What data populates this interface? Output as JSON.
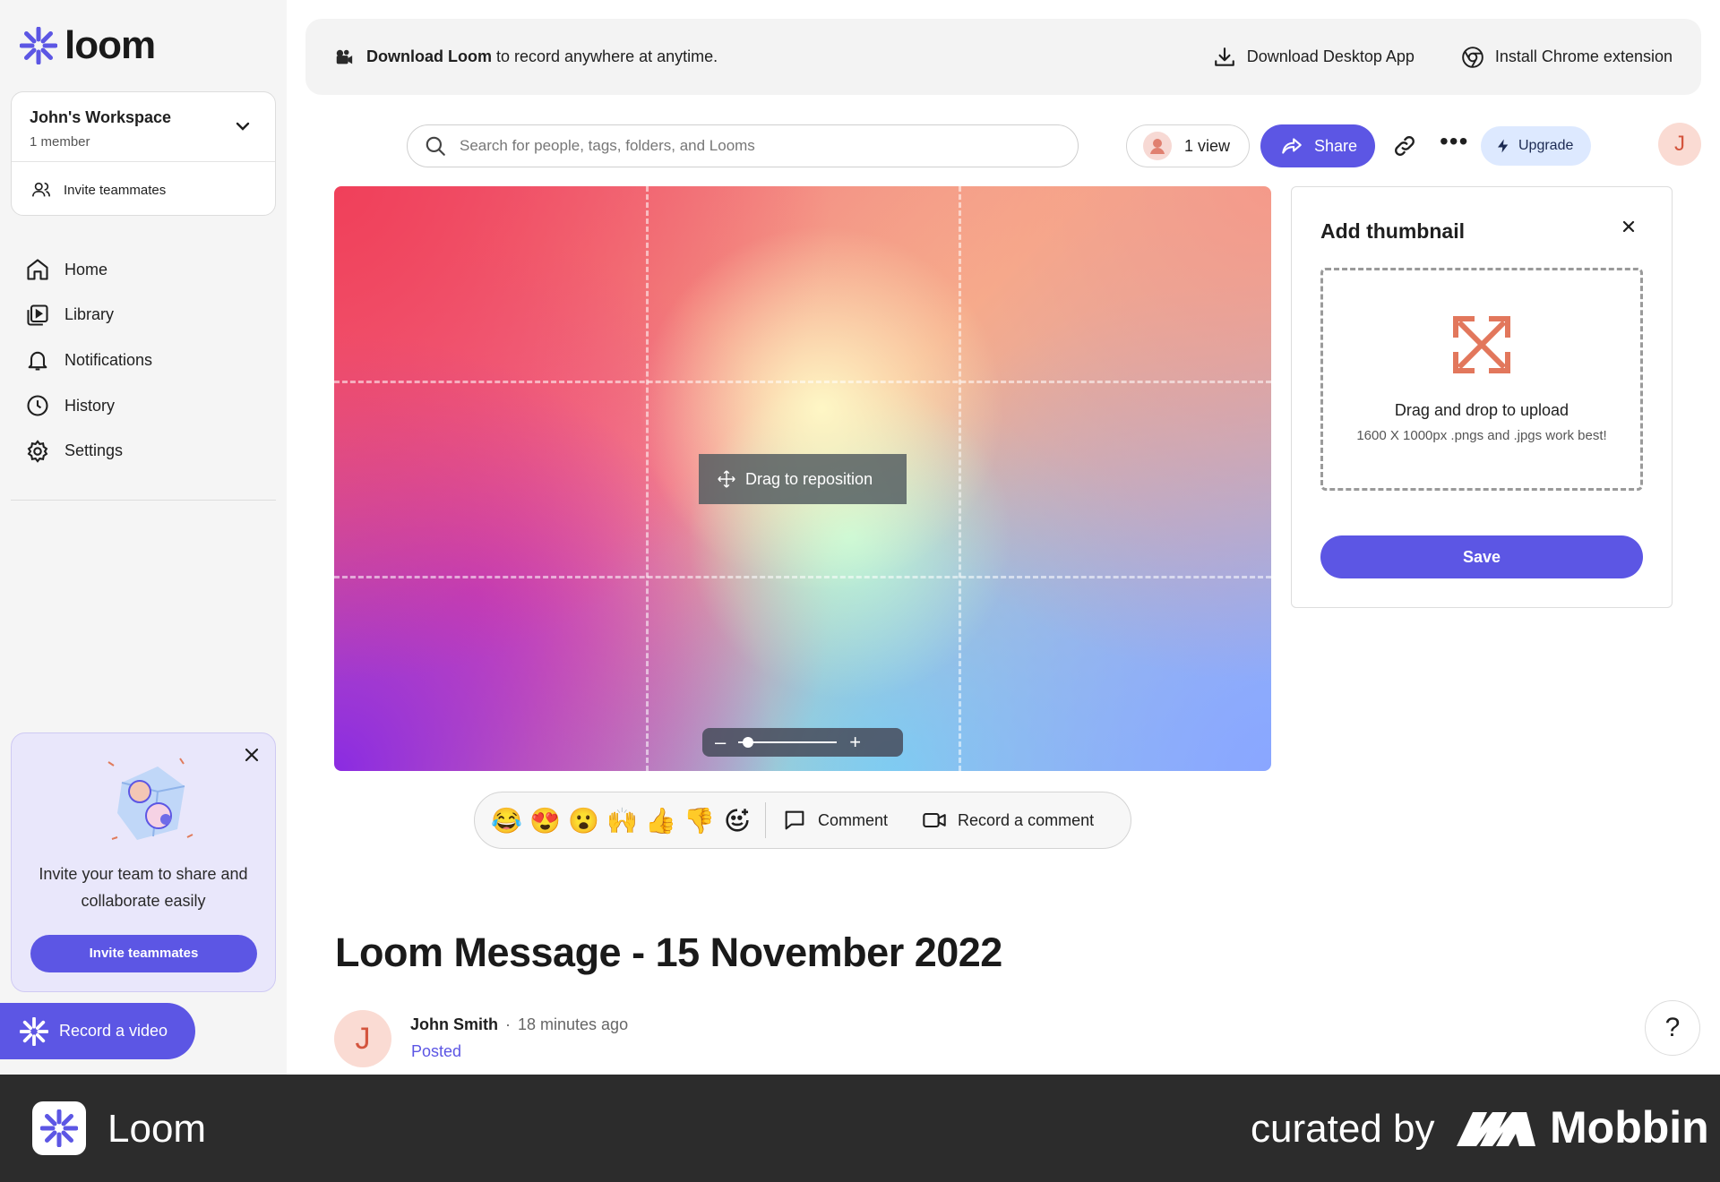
{
  "brand": {
    "logo_text": "loom",
    "accent": "#5c56e4"
  },
  "workspace": {
    "name": "John's Workspace",
    "members": "1 member",
    "invite_label": "Invite teammates"
  },
  "nav": {
    "items": [
      {
        "label": "Home",
        "icon": "home-icon"
      },
      {
        "label": "Library",
        "icon": "library-icon"
      },
      {
        "label": "Notifications",
        "icon": "bell-icon"
      },
      {
        "label": "History",
        "icon": "clock-icon"
      },
      {
        "label": "Settings",
        "icon": "gear-icon"
      }
    ]
  },
  "promo": {
    "text": "Invite your team to share and collaborate easily",
    "button": "Invite teammates"
  },
  "record_button": "Record a video",
  "banner": {
    "bold": "Download Loom",
    "rest": "to record anywhere at anytime.",
    "download_app": "Download Desktop App",
    "chrome_ext": "Install Chrome extension"
  },
  "search": {
    "placeholder": "Search for people, tags, folders, and Looms"
  },
  "toolbar": {
    "views": "1 view",
    "share": "Share",
    "upgrade": "Upgrade",
    "user_initial": "J"
  },
  "video": {
    "drag_tip": "Drag to reposition",
    "zoom_level": 0.1
  },
  "reactions": {
    "emojis": [
      "😂",
      "😍",
      "😮",
      "🙌",
      "👍",
      "👎"
    ],
    "comment": "Comment",
    "record_comment": "Record a comment"
  },
  "thumbnail_panel": {
    "title": "Add thumbnail",
    "drop_title": "Drag and drop to upload",
    "drop_hint": "1600 X 1000px .pngs and .jpgs work best!",
    "save": "Save"
  },
  "message": {
    "title": "Loom Message - 15 November 2022",
    "author": "John Smith",
    "time": "18 minutes ago",
    "status": "Posted",
    "author_initial": "J"
  },
  "help": "?",
  "footer": {
    "app_name": "Loom",
    "curated": "curated by",
    "brand": "Mobbin"
  }
}
